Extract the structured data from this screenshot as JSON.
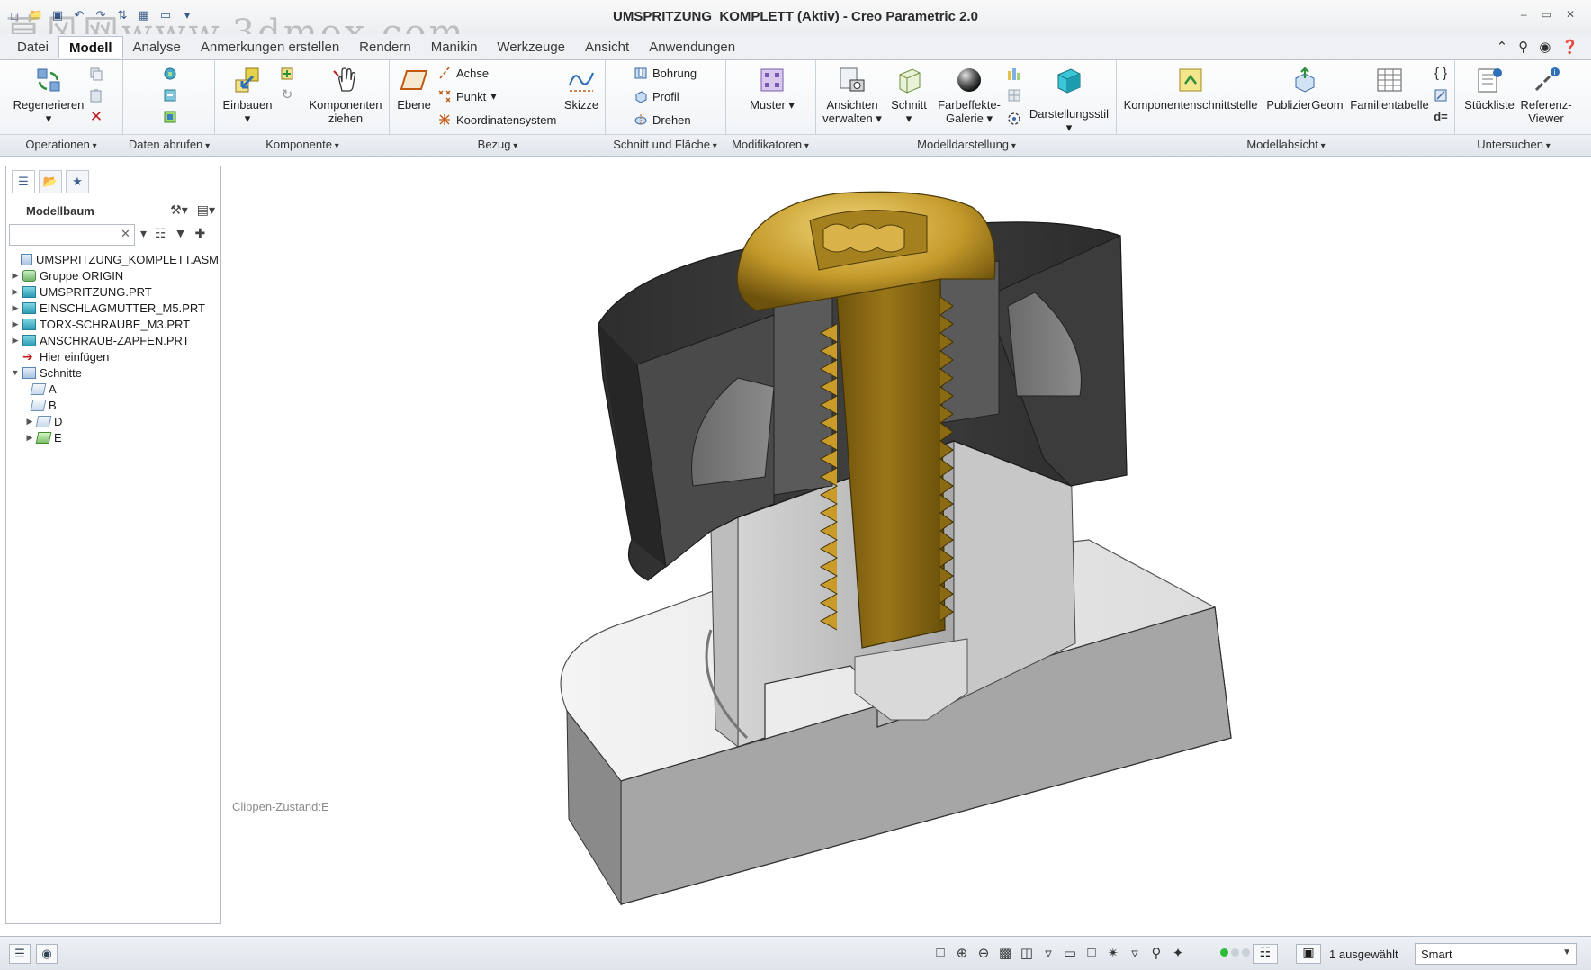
{
  "window": {
    "title": "UMSPRITZUNG_KOMPLETT (Aktiv) - Creo Parametric 2.0",
    "watermark": "莫风网www.3dmox.com",
    "controls": [
      "–",
      "▭",
      "✕"
    ]
  },
  "quick_access": [
    "new-icon",
    "open-icon",
    "save-icon",
    "undo-icon",
    "redo-icon",
    "regenerate-icon",
    "windows-icon",
    "close-window-icon",
    "customize-icon"
  ],
  "menu": {
    "tabs": [
      "Datei",
      "Modell",
      "Analyse",
      "Anmerkungen erstellen",
      "Rendern",
      "Manikin",
      "Werkzeuge",
      "Ansicht",
      "Anwendungen"
    ],
    "active": "Modell"
  },
  "ribbon": {
    "operationen": {
      "regenerieren": "Regenerieren",
      "label": "Operationen"
    },
    "daten_abrufen": {
      "label": "Daten abrufen"
    },
    "komponente": {
      "einbauen": "Einbauen",
      "komponenten_ziehen_1": "Komponenten",
      "komponenten_ziehen_2": "ziehen",
      "label": "Komponente"
    },
    "bezug": {
      "ebene": "Ebene",
      "achse": "Achse",
      "punkt": "Punkt",
      "koordinatensystem": "Koordinatensystem",
      "skizze": "Skizze",
      "label": "Bezug"
    },
    "schnitt_flaeche": {
      "bohrung": "Bohrung",
      "profil": "Profil",
      "drehen": "Drehen",
      "label": "Schnitt und Fläche"
    },
    "modifikatoren": {
      "muster": "Muster",
      "label": "Modifikatoren"
    },
    "modelldarstellung": {
      "ansichten_1": "Ansichten",
      "ansichten_2": "verwalten",
      "schnitt": "Schnitt",
      "farbeffekte_1": "Farbeffekte-",
      "farbeffekte_2": "Galerie",
      "darstellungsstil": "Darstellungsstil",
      "label": "Modelldarstellung"
    },
    "modellabsicht": {
      "komponentenschnittstelle": "Komponentenschnittstelle",
      "publiziergeom": "PublizierGeom",
      "familientabelle": "Familientabelle",
      "label": "Modellabsicht"
    },
    "untersuchen": {
      "stueckliste": "Stückliste",
      "referenz_1": "Referenz-",
      "referenz_2": "Viewer",
      "deq": "d=",
      "label": "Untersuchen"
    }
  },
  "model_tree": {
    "title": "Modellbaum",
    "search_value": "",
    "items": [
      {
        "label": "UMSPRITZUNG_KOMPLETT.ASM",
        "icon": "assembly-icon",
        "expanded": true
      },
      {
        "label": "Gruppe ORIGIN",
        "icon": "group-icon"
      },
      {
        "label": "UMSPRITZUNG.PRT",
        "icon": "part-icon"
      },
      {
        "label": "EINSCHLAGMUTTER_M5.PRT",
        "icon": "part-icon"
      },
      {
        "label": "TORX-SCHRAUBE_M3.PRT",
        "icon": "part-icon"
      },
      {
        "label": "ANSCHRAUB-ZAPFEN.PRT",
        "icon": "part-icon"
      },
      {
        "label": "Hier einfügen",
        "icon": "insert-here-icon"
      },
      {
        "label": "Schnitte",
        "icon": "section-folder-icon",
        "expanded": true
      },
      {
        "label": "A",
        "icon": "section-icon"
      },
      {
        "label": "B",
        "icon": "section-icon"
      },
      {
        "label": "D",
        "icon": "section-icon"
      },
      {
        "label": "E",
        "icon": "section-active-icon"
      }
    ]
  },
  "viewport": {
    "clip_state": "Clippen-Zustand:E"
  },
  "statusbar": {
    "selected": "1 ausgewählt",
    "filter": "Smart",
    "status_colors": [
      "#2ebd3a",
      "#c8d0d8",
      "#c8d0d8"
    ]
  },
  "colors": {
    "accent": "#2a9bb4",
    "bolt": "#8a6a12",
    "housing": "#444444",
    "base": "#b8b8b8"
  }
}
